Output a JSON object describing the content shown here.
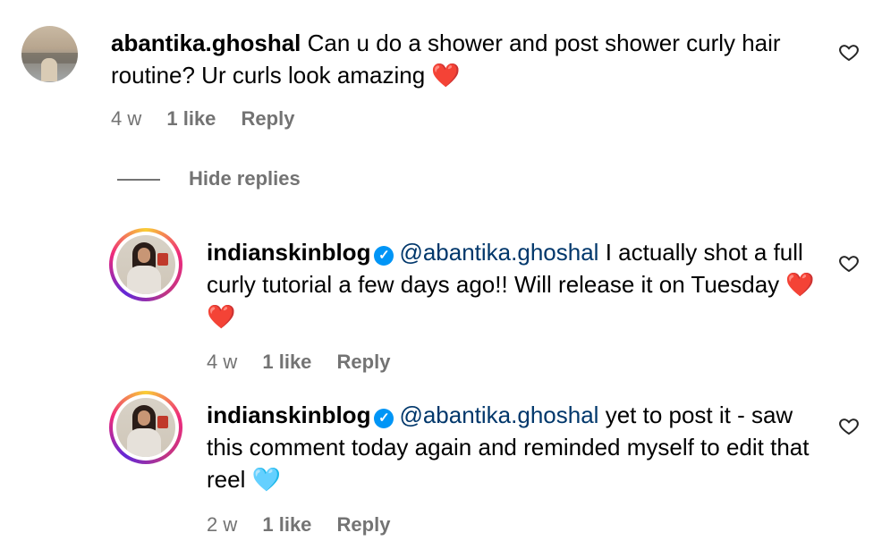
{
  "comments": [
    {
      "username": "abantika.ghoshal",
      "verified": false,
      "text": "Can u do a shower and post shower curly hair routine? Ur curls look amazing",
      "emoji": "❤️",
      "time": "4 w",
      "likes": "1 like",
      "reply": "Reply"
    }
  ],
  "hide_replies": "Hide replies",
  "replies": [
    {
      "username": "indianskinblog",
      "verified": true,
      "verified_glyph": "✓",
      "mention": "@abantika.ghoshal",
      "text": "I actually shot a full curly tutorial a few days ago!! Will release it on Tuesday",
      "emoji": "❤️❤️",
      "time": "4 w",
      "likes": "1 like",
      "reply": "Reply"
    },
    {
      "username": "indianskinblog",
      "verified": true,
      "verified_glyph": "✓",
      "mention": "@abantika.ghoshal",
      "text": "yet to post it - saw this comment today again and reminded myself to edit that reel",
      "emoji": "🩵",
      "time": "2 w",
      "likes": "1 like",
      "reply": "Reply"
    }
  ],
  "icons": {
    "like": "heart-outline-icon",
    "verified": "verified-badge-icon"
  },
  "colors": {
    "mention": "#00376b",
    "meta": "#737373",
    "verified": "#0095f6"
  }
}
